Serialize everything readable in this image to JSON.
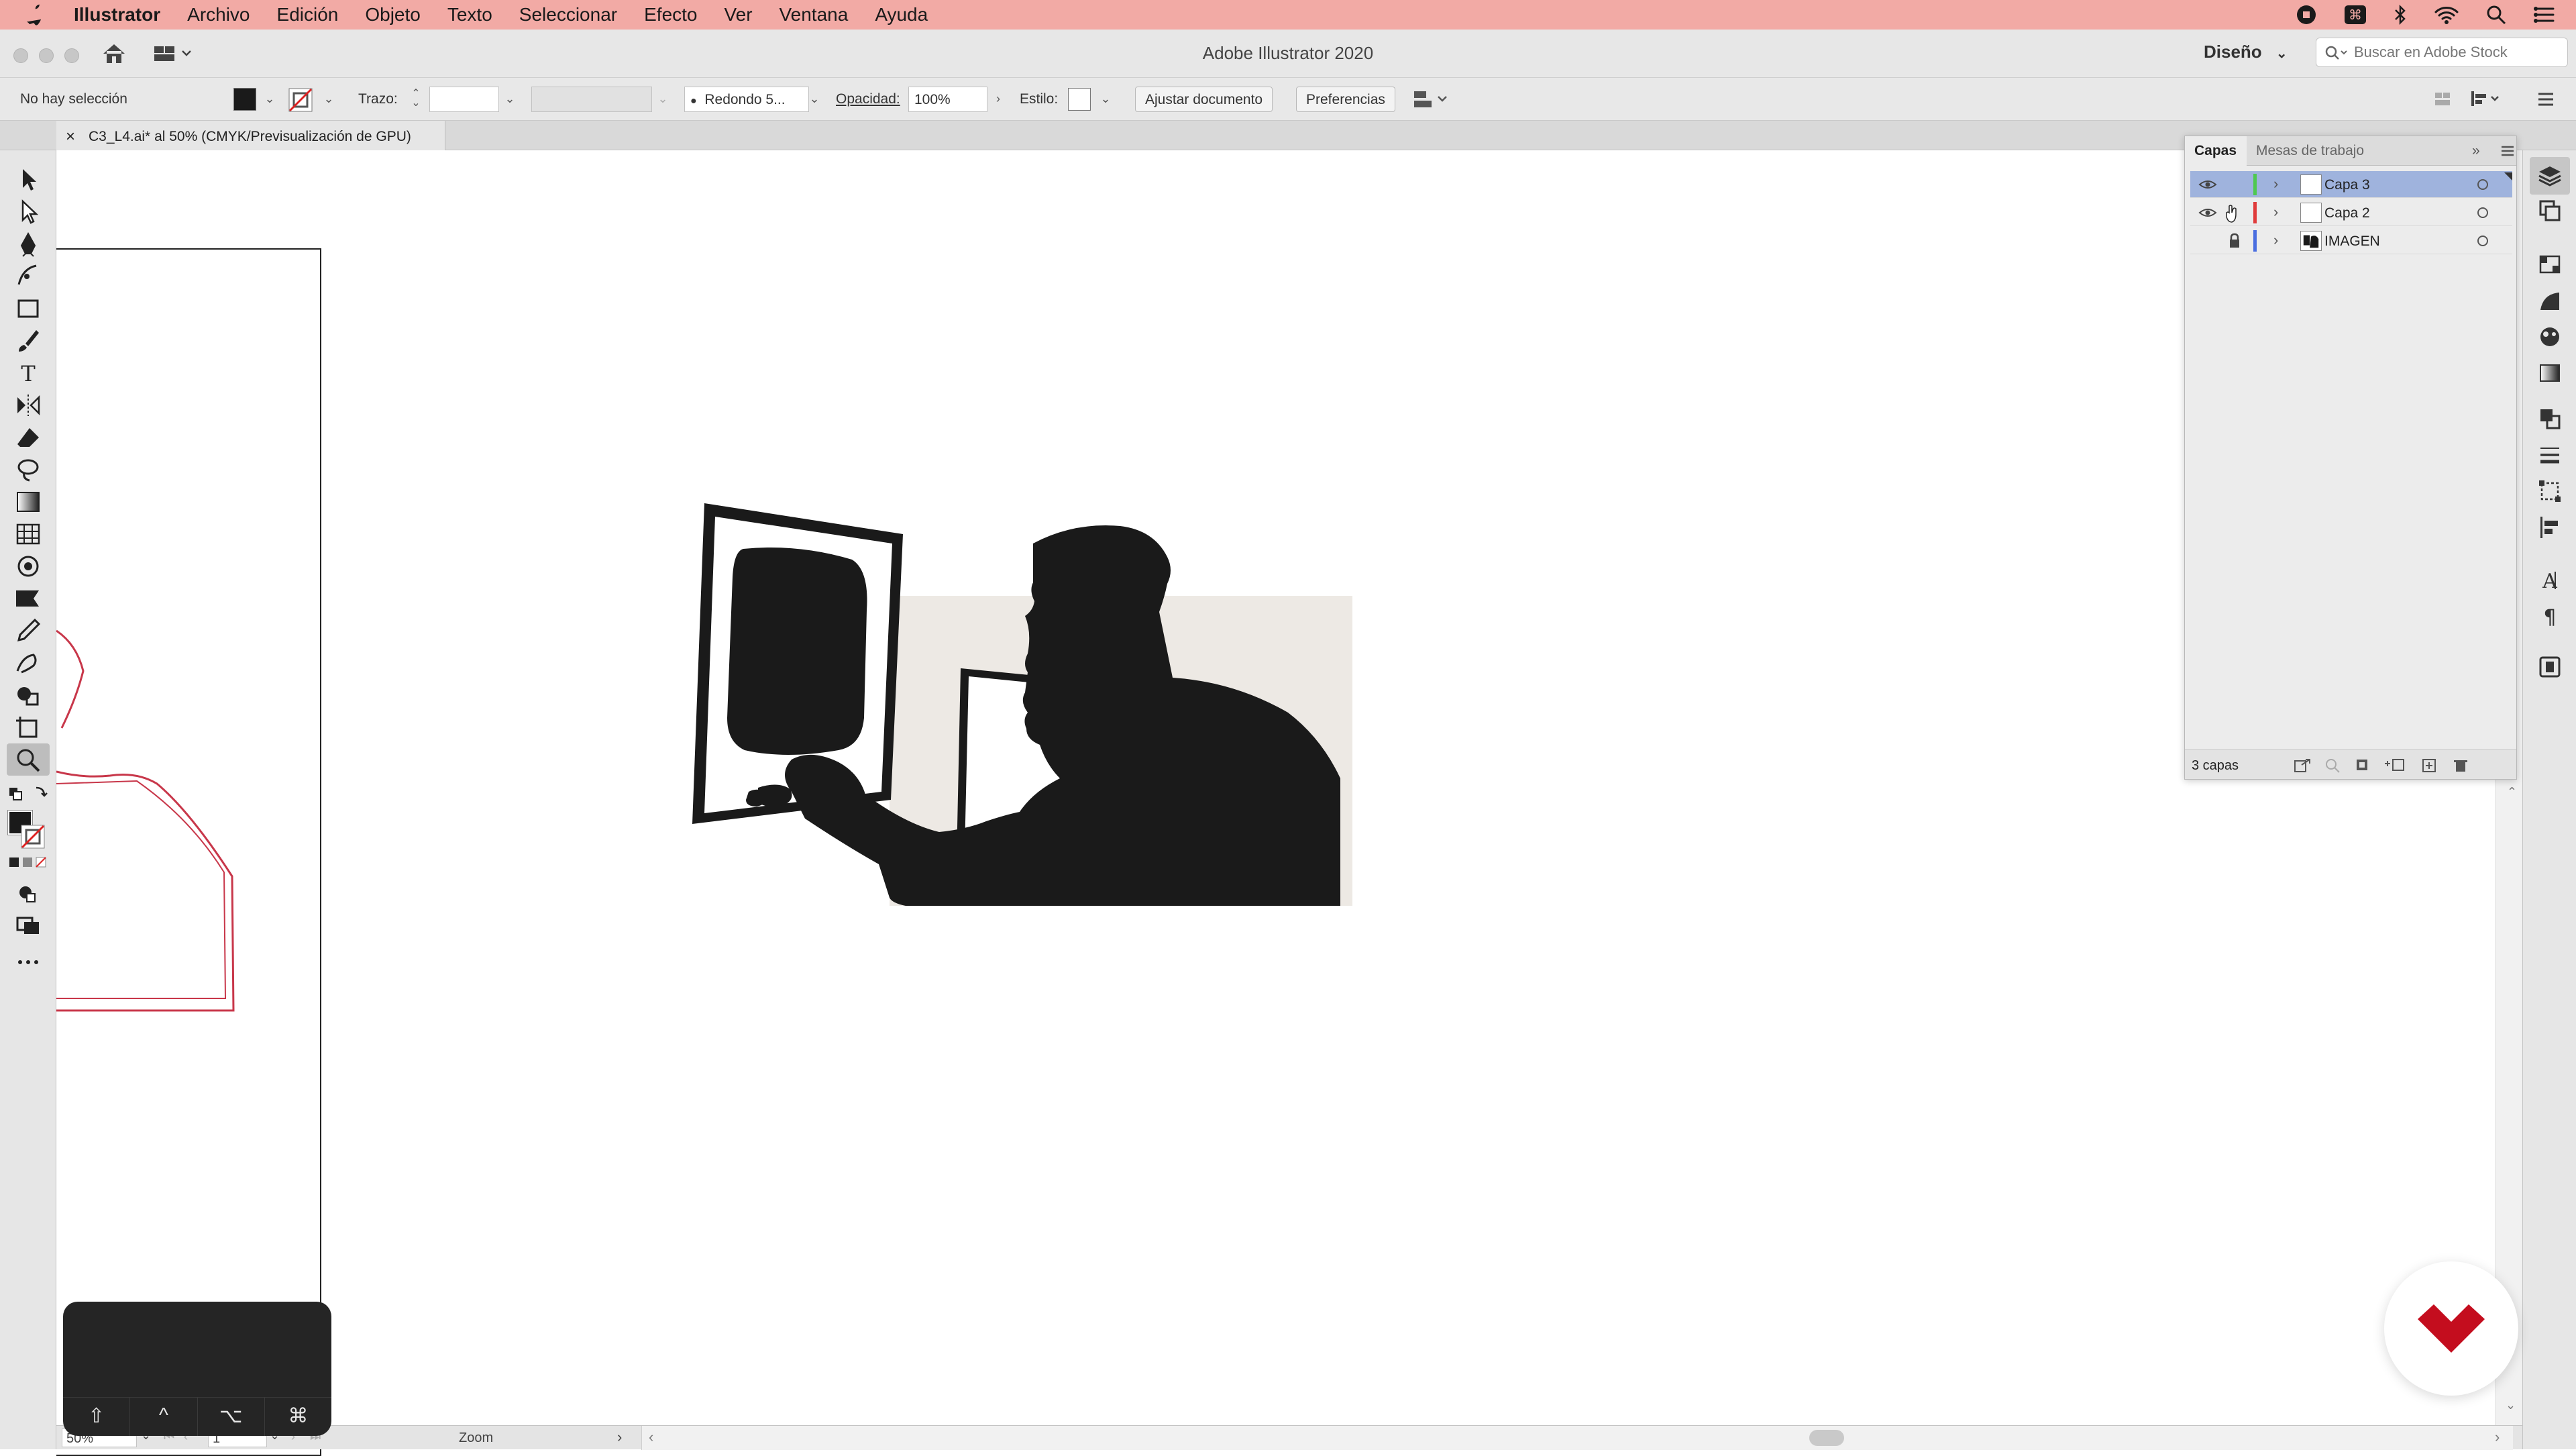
{
  "menubar": {
    "app_name": "Illustrator",
    "items": [
      "Archivo",
      "Edición",
      "Objeto",
      "Texto",
      "Seleccionar",
      "Efecto",
      "Ver",
      "Ventana",
      "Ayuda"
    ]
  },
  "window": {
    "title": "Adobe Illustrator 2020",
    "workspace": "Diseño",
    "stock_search_placeholder": "Buscar en Adobe Stock"
  },
  "controlbar": {
    "selection_status": "No hay selección",
    "stroke_label": "Trazo:",
    "brush_label": "Redondo 5...",
    "opacity_label": "Opacidad:",
    "opacity_value": "100%",
    "style_label": "Estilo:",
    "fit_document_button": "Ajustar documento",
    "preferences_button": "Preferencias"
  },
  "document": {
    "tab_title": "C3_L4.ai* al 50% (CMYK/Previsualización de GPU)"
  },
  "layers_panel": {
    "tabs": [
      "Capas",
      "Mesas de trabajo"
    ],
    "layers": [
      {
        "name": "Capa 3",
        "color": "#4fc94f",
        "visible": true,
        "locked": false,
        "selected": true
      },
      {
        "name": "Capa 2",
        "color": "#e03b3b",
        "visible": true,
        "locked": false,
        "selected": false
      },
      {
        "name": "IMAGEN",
        "color": "#4a6ee0",
        "visible": false,
        "locked": true,
        "selected": false
      }
    ],
    "footer_count": "3 capas"
  },
  "statusbar": {
    "zoom_value": "50%",
    "artboard_number": "1",
    "tool_name": "Zoom"
  },
  "keyboard_overlay": {
    "keys": [
      "⇧",
      "^",
      "⌥",
      "⌘"
    ]
  },
  "colors": {
    "menubar_bg": "#f2aaa5",
    "selection_row": "#9fb3dd",
    "illustration_ink": "#1a1a1a",
    "illustration_backdrop": "#ede9e4",
    "outline_red": "#c8374a",
    "logo_red": "#c40d1e"
  }
}
